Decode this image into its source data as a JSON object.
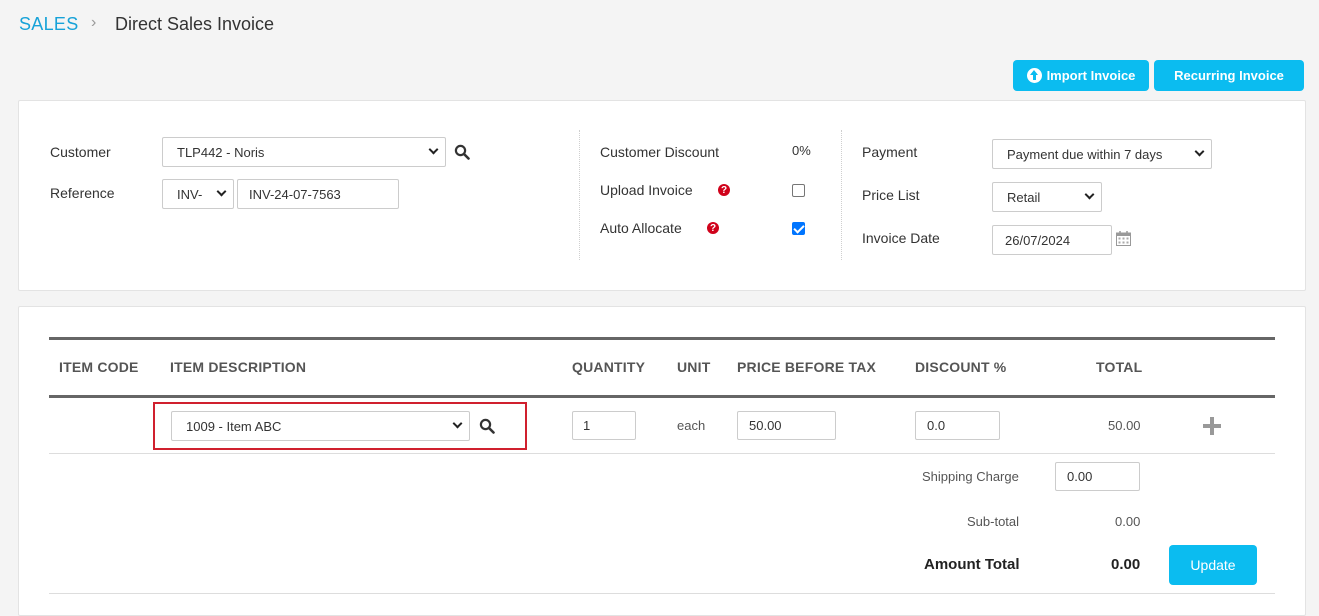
{
  "breadcrumb": {
    "section": "SALES",
    "separator": "›",
    "title": "Direct Sales Invoice"
  },
  "actions": {
    "import_label": "Import Invoice",
    "recurring_label": "Recurring Invoice"
  },
  "form": {
    "customer_label": "Customer",
    "customer_value": "TLP442 - Noris",
    "reference_label": "Reference",
    "reference_prefix": "INV-",
    "reference_value": "INV-24-07-7563",
    "customer_discount_label": "Customer Discount",
    "customer_discount_value": "0%",
    "upload_invoice_label": "Upload Invoice",
    "upload_invoice_checked": false,
    "auto_allocate_label": "Auto Allocate",
    "auto_allocate_checked": true,
    "payment_label": "Payment",
    "payment_value": "Payment due within 7 days",
    "price_list_label": "Price List",
    "price_list_value": "Retail",
    "invoice_date_label": "Invoice Date",
    "invoice_date_value": "26/07/2024"
  },
  "table": {
    "headers": {
      "item_code": "ITEM CODE",
      "item_description": "ITEM DESCRIPTION",
      "quantity": "QUANTITY",
      "unit": "UNIT",
      "price_before_tax": "PRICE BEFORE TAX",
      "discount": "DISCOUNT %",
      "total": "TOTAL"
    },
    "row": {
      "item_code": "",
      "item_description": "1009 - Item ABC",
      "quantity": "1",
      "unit": "each",
      "price_before_tax": "50.00",
      "discount": "0.0",
      "total": "50.00"
    }
  },
  "totals": {
    "shipping_label": "Shipping Charge",
    "shipping_value": "0.00",
    "subtotal_label": "Sub-total",
    "subtotal_value": "0.00",
    "amount_total_label": "Amount Total",
    "amount_total_value": "0.00",
    "update_label": "Update"
  },
  "icons": {
    "search": "search-icon",
    "help": "help-icon",
    "calendar": "calendar-icon",
    "upload": "upload-circle-icon",
    "add": "plus-icon"
  },
  "colors": {
    "accent": "#0bbcf0",
    "link": "#17a2d8",
    "help": "#d0021b",
    "highlight": "#d0202e"
  }
}
